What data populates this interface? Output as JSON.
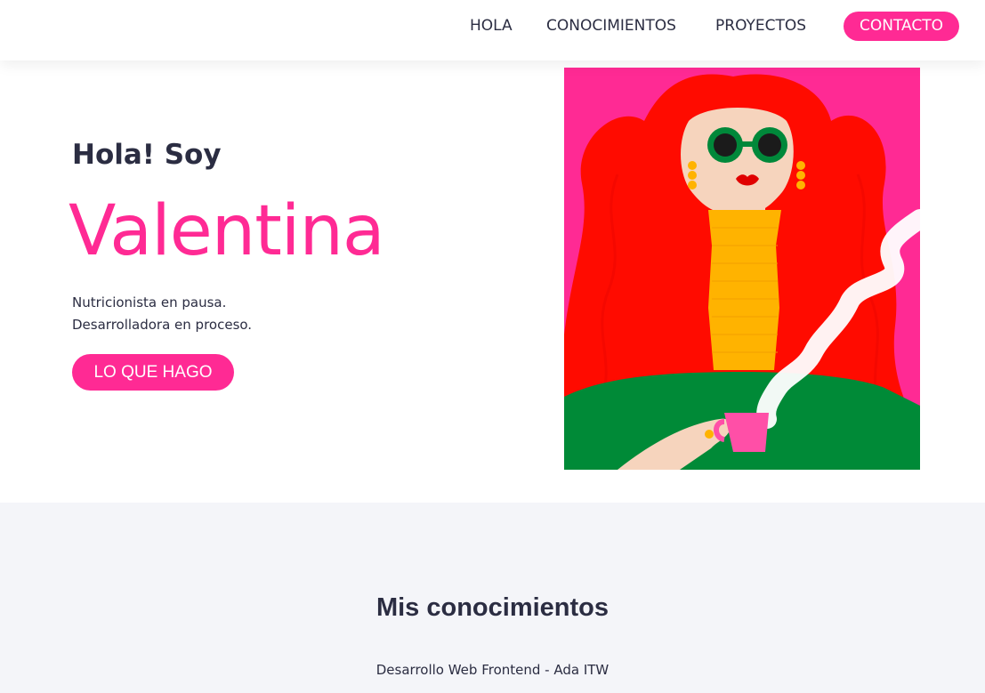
{
  "nav": {
    "links": [
      "HOLA",
      "CONOCIMIENTOS",
      "PROYECTOS"
    ],
    "cta": "CONTACTO"
  },
  "hero": {
    "greeting": "Hola! Soy",
    "name": "Valentina",
    "tagline": [
      "Nutricionista en pausa.",
      "Desarrolladora en proceso."
    ],
    "button": "LO QUE HAGO",
    "illustration": "woman-with-coffee-illustration"
  },
  "skills": {
    "title": "Mis conocimientos",
    "items": [
      "Desarrollo Web Frontend - Ada ITW"
    ]
  },
  "colors": {
    "accent": "#ff2a94",
    "text": "#2b2d42",
    "section_bg": "#f4f5f9",
    "illustration_bg": "#ff2a94",
    "hair": "#ff0b00",
    "sweater": "#ffb300",
    "shirt": "#008a37",
    "skin": "#f6d4bd",
    "glasses": "#00883a"
  }
}
